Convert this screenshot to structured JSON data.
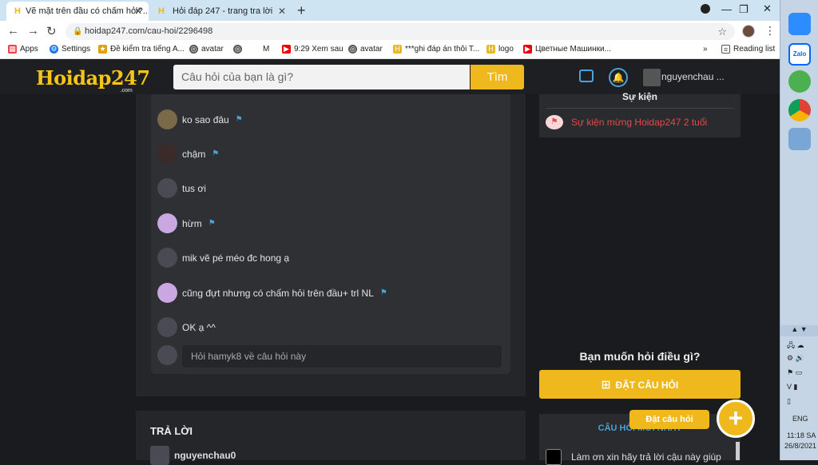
{
  "browser": {
    "tabs": [
      {
        "title": "Vẽ mặt trên đầu có chấm hỏi?..."
      },
      {
        "title": "Hỏi đáp 247 - trang tra lời"
      }
    ],
    "url": "hoidap247.com/cau-hoi/2296498",
    "bookmarks": [
      "Apps",
      "Settings",
      "Đề kiểm tra tiếng A...",
      "avatar",
      "M",
      "9:29 Xem sau",
      "avatar",
      "***ghi đáp án thôi T...",
      "logo",
      "Цветные Машинки...",
      "Reading list"
    ]
  },
  "header": {
    "logo": "Hoidap247",
    "logo_sub": ".com",
    "search_placeholder": "Câu hỏi của bạn là gì?",
    "search_button": "Tìm",
    "username": "nguyenchau ..."
  },
  "comments": [
    {
      "text": "ko sao đâu",
      "flag": true,
      "avatar": "#7a6a4a"
    },
    {
      "text": "chậm",
      "flag": true,
      "avatar": "#3a2a2a"
    },
    {
      "text": "tus ơi",
      "flag": false,
      "avatar": "#4a4a55"
    },
    {
      "text": "hừm",
      "flag": true,
      "avatar": "#c9a7e0"
    },
    {
      "text": "mik vẽ pé méo đc hong ạ",
      "flag": false,
      "avatar": "#4a4a55"
    },
    {
      "text": "cũng đựt nhưng có chấm hỏi trên đầu+ trl NL",
      "flag": true,
      "avatar": "#c9a7e0"
    },
    {
      "text": "OK ạ ^^",
      "flag": false,
      "avatar": "#4a4a55"
    }
  ],
  "reply_placeholder": "Hỏi hamyk8 về câu hỏi này",
  "answers": {
    "title": "TRẢ LỜI",
    "user": "nguyenchau0"
  },
  "sidebar": {
    "event_title": "Sự kiện",
    "event_link": "Sự kiện mừng Hoidap247 2 tuổi",
    "ask_heading": "Bạn muốn hỏi điều gì?",
    "ask_button": "ĐẶT CÂU HỎI",
    "latest_title": "CÂU HỎI MỚI NHẤT",
    "latest_item": "Làm ơn xin hãy trả lời cậu này giúp",
    "fab_label": "Đặt câu hỏi"
  },
  "taskbar": {
    "lang": "ENG",
    "time": "11:18 SA",
    "date": "26/8/2021"
  },
  "colors": {
    "accent": "#efb81d",
    "link_blue": "#4aa3d6",
    "event_red": "#e14b4b"
  }
}
